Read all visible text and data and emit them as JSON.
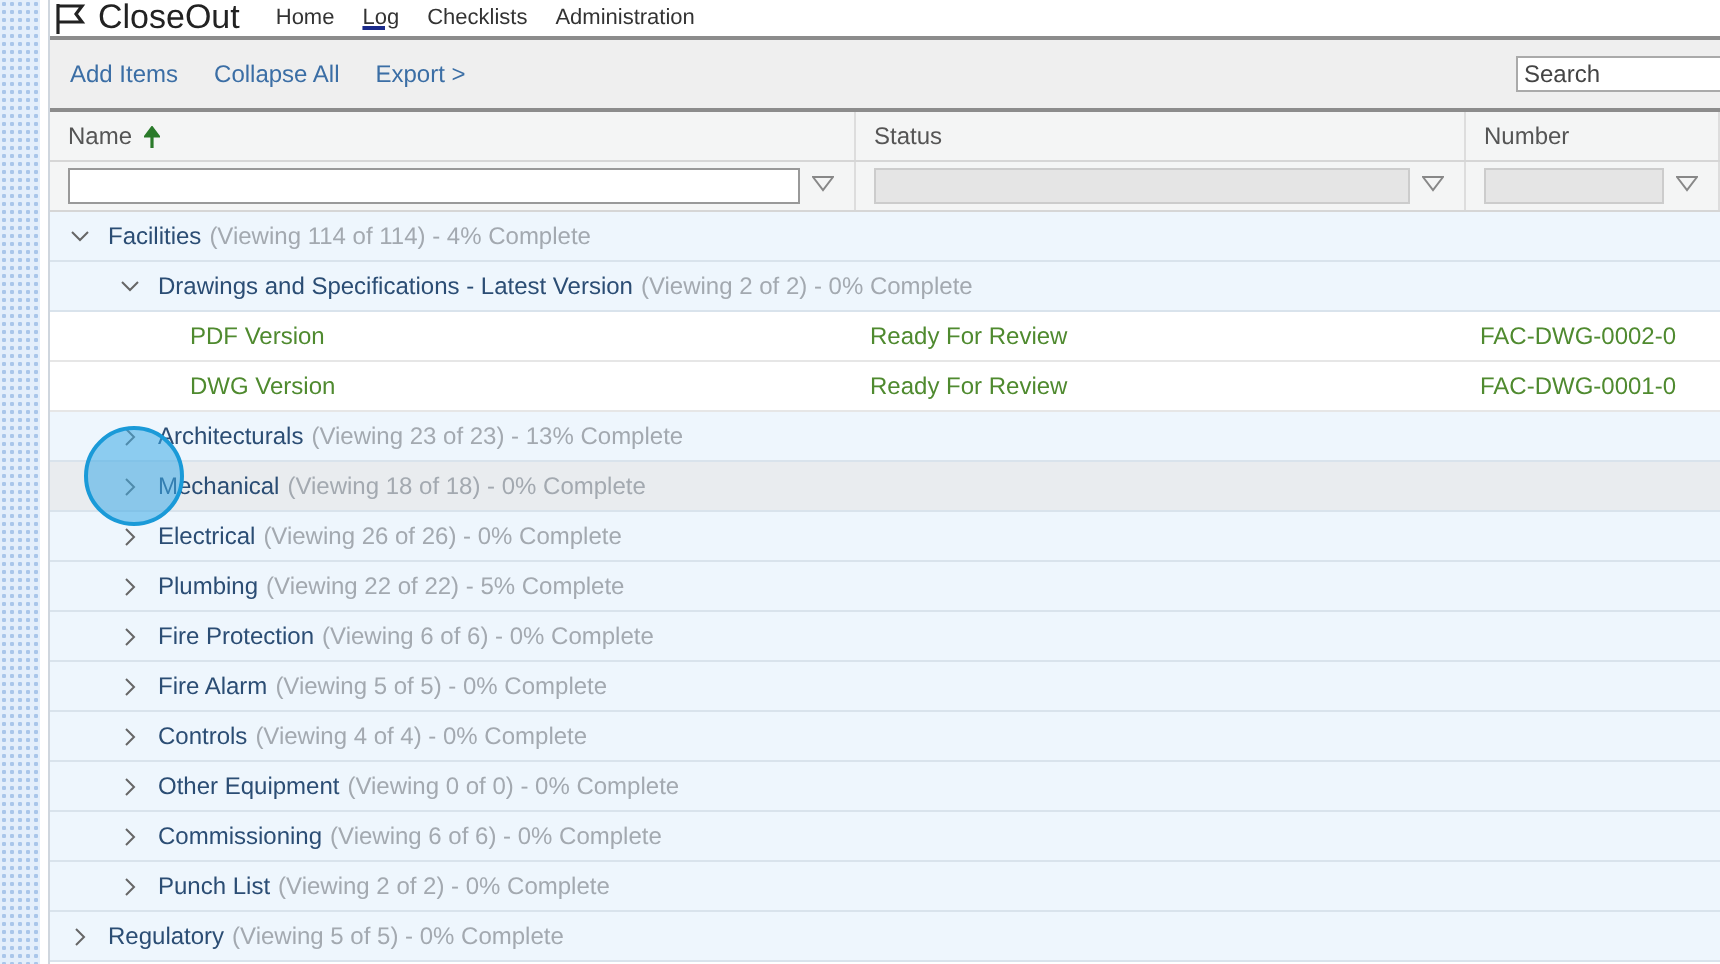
{
  "app": {
    "logo": "CloseOut",
    "nav": [
      {
        "label": "Home",
        "selected": false
      },
      {
        "label": "Log",
        "selected": true
      },
      {
        "label": "Checklists",
        "selected": false
      },
      {
        "label": "Administration",
        "selected": false
      }
    ]
  },
  "toolbar": {
    "actions": [
      "Add Items",
      "Collapse All",
      "Export >"
    ],
    "search": {
      "placeholder": "Search"
    }
  },
  "table": {
    "columns": [
      {
        "label": "Name",
        "sorted": true
      },
      {
        "label": "Status",
        "sorted": false
      },
      {
        "label": "Number",
        "sorted": false
      }
    ],
    "filters": [
      {
        "disabled": false
      },
      {
        "disabled": true
      },
      {
        "disabled": true
      }
    ],
    "rows": [
      {
        "kind": "group",
        "label": "Facilities",
        "summary": "(Viewing 114 of 114) - 4% Complete",
        "expanded": true,
        "hovered": false,
        "children": [
          {
            "kind": "group",
            "label": "Drawings and Specifications - Latest Version",
            "summary": "(Viewing 2 of 2) - 0% Complete",
            "expanded": true,
            "hovered": false,
            "children": [
              {
                "kind": "item",
                "label": "PDF Version",
                "status": "Ready For Review",
                "number": "FAC-DWG-0002-0",
                "hovered": false
              },
              {
                "kind": "item",
                "label": "DWG Version",
                "status": "Ready For Review",
                "number": "FAC-DWG-0001-0",
                "hovered": false
              }
            ]
          },
          {
            "kind": "group",
            "label": "Architecturals",
            "summary": "(Viewing 23 of 23) - 13% Complete",
            "expanded": false,
            "hovered": false
          },
          {
            "kind": "group",
            "label": "Mechanical",
            "summary": "(Viewing 18 of 18) - 0% Complete",
            "expanded": false,
            "hovered": true
          },
          {
            "kind": "group",
            "label": "Electrical",
            "summary": "(Viewing 26 of 26) - 0% Complete",
            "expanded": false,
            "hovered": false
          },
          {
            "kind": "group",
            "label": "Plumbing",
            "summary": "(Viewing 22 of 22) - 5% Complete",
            "expanded": false,
            "hovered": false
          },
          {
            "kind": "group",
            "label": "Fire Protection",
            "summary": "(Viewing 6 of 6) - 0% Complete",
            "expanded": false,
            "hovered": false
          },
          {
            "kind": "group",
            "label": "Fire Alarm",
            "summary": "(Viewing 5 of 5) - 0% Complete",
            "expanded": false,
            "hovered": false
          },
          {
            "kind": "group",
            "label": "Controls",
            "summary": "(Viewing 4 of 4) - 0% Complete",
            "expanded": false,
            "hovered": false
          },
          {
            "kind": "group",
            "label": "Other Equipment",
            "summary": "(Viewing 0 of 0) - 0% Complete",
            "expanded": false,
            "hovered": false
          },
          {
            "kind": "group",
            "label": "Commissioning",
            "summary": "(Viewing 6 of 6) - 0% Complete",
            "expanded": false,
            "hovered": false
          },
          {
            "kind": "group",
            "label": "Punch List",
            "summary": "(Viewing 2 of 2) - 0% Complete",
            "expanded": false,
            "hovered": false
          }
        ]
      },
      {
        "kind": "group",
        "label": "Regulatory",
        "summary": "(Viewing 5 of 5) - 0% Complete",
        "expanded": false,
        "hovered": false
      }
    ]
  }
}
